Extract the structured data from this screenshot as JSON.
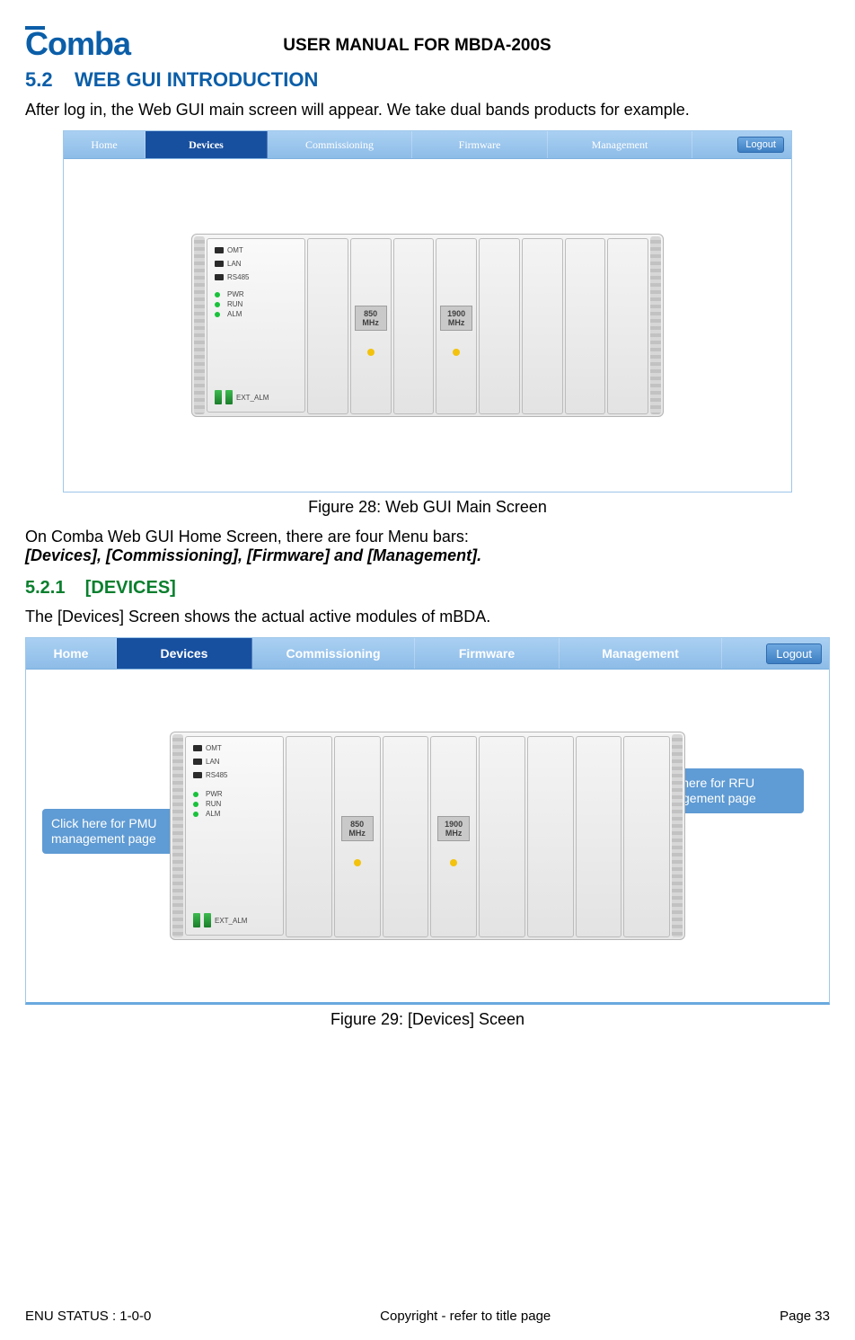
{
  "header": {
    "logo_text": "Comba",
    "doc_title": "USER MANUAL FOR MBDA-200S"
  },
  "section52": {
    "number": "5.2",
    "title": "WEB GUI INTRODUCTION",
    "intro": "After log in, the Web GUI main screen will appear. We take dual bands products for example."
  },
  "fig28": {
    "nav": {
      "home": "Home",
      "devices": "Devices",
      "commissioning": "Commissioning",
      "firmware": "Firmware",
      "management": "Management",
      "logout": "Logout"
    },
    "pmu": {
      "omt": "OMT",
      "lan": "LAN",
      "rs485": "RS485",
      "pwr": "PWR",
      "run": "RUN",
      "alm": "ALM",
      "ext": "EXT_ALM"
    },
    "slot1": {
      "l1": "850",
      "l2": "MHz"
    },
    "slot2": {
      "l1": "1900",
      "l2": "MHz"
    },
    "caption": "Figure 28: Web GUI Main Screen"
  },
  "mid_text": {
    "line1": "On Comba Web GUI Home Screen, there are four Menu bars:",
    "line2": "[Devices], [Commissioning], [Firmware] and [Management]."
  },
  "section521": {
    "number": "5.2.1",
    "title": "[DEVICES]",
    "intro": "The [Devices] Screen shows the actual active modules of mBDA."
  },
  "fig29": {
    "nav": {
      "home": "Home",
      "devices": "Devices",
      "commissioning": "Commissioning",
      "firmware": "Firmware",
      "management": "Management",
      "logout": "Logout"
    },
    "pmu": {
      "omt": "OMT",
      "lan": "LAN",
      "rs485": "RS485",
      "pwr": "PWR",
      "run": "RUN",
      "alm": "ALM",
      "ext": "EXT_ALM"
    },
    "slot1": {
      "l1": "850",
      "l2": "MHz"
    },
    "slot2": {
      "l1": "1900",
      "l2": "MHz"
    },
    "callout_left": "Click here for PMU management page",
    "callout_right": "Click here for RFU management page",
    "caption": "Figure 29: [Devices] Sceen"
  },
  "footer": {
    "left": "ENU STATUS : 1-0-0",
    "center": "Copyright - refer to title page",
    "right": "Page 33"
  }
}
